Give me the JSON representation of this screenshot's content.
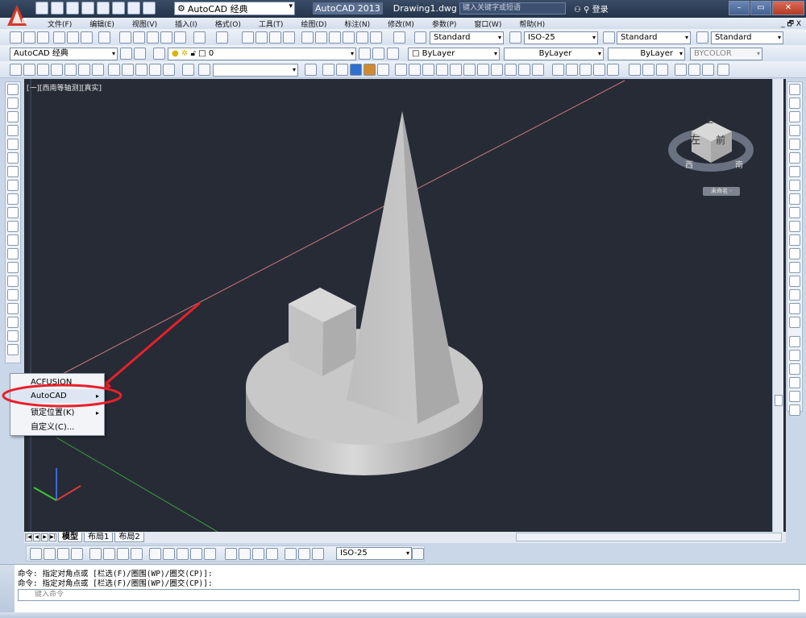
{
  "title": {
    "workspace": "AutoCAD 经典",
    "app": "AutoCAD 2013",
    "file": "Drawing1.dwg",
    "search_placeholder": "键入关键字或短语",
    "login": "登录"
  },
  "menu": [
    "文件(F)",
    "编辑(E)",
    "视图(V)",
    "插入(I)",
    "格式(O)",
    "工具(T)",
    "绘图(D)",
    "标注(N)",
    "修改(M)",
    "参数(P)",
    "窗口(W)",
    "帮助(H)"
  ],
  "menu_mdi": "_ 🗗 X",
  "styles": {
    "text_style": "Standard",
    "dim_style": "ISO-25",
    "table_style": "Standard",
    "multileader_style": "Standard"
  },
  "layers": {
    "workspace_select": "AutoCAD 经典",
    "layer_select": "0",
    "color": "ByLayer",
    "linetype": "ByLayer",
    "lineweight": "ByLayer",
    "plot_style": "BYCOLOR"
  },
  "viewport": {
    "label": "[一][西南等轴测][真实]",
    "viewcube": {
      "top": "上",
      "left": "左",
      "front": "前",
      "west": "西",
      "south": "南",
      "ucs_label": "未命名 -"
    }
  },
  "context_menu": {
    "items": [
      {
        "label": "ACFUSION",
        "has_sub": false
      },
      {
        "label": "AutoCAD",
        "has_sub": true
      },
      {
        "label": "锁定位置(K)",
        "has_sub": true
      },
      {
        "label": "自定义(C)...",
        "has_sub": false
      }
    ]
  },
  "tabs": [
    "模型",
    "布局1",
    "布局2"
  ],
  "dim_toolbar": {
    "dim_style": "ISO-25"
  },
  "command": {
    "lines": [
      "命令: 指定对角点或 [栏选(F)/圈围(WP)/圈交(CP)]:",
      "命令: 指定对角点或 [栏选(F)/圈围(WP)/圈交(CP)]:"
    ],
    "placeholder": "键入命令"
  },
  "colors": {
    "viewport_bg": "#262b36",
    "annotation": "#e8202a",
    "solid": "#bfbfbf"
  }
}
